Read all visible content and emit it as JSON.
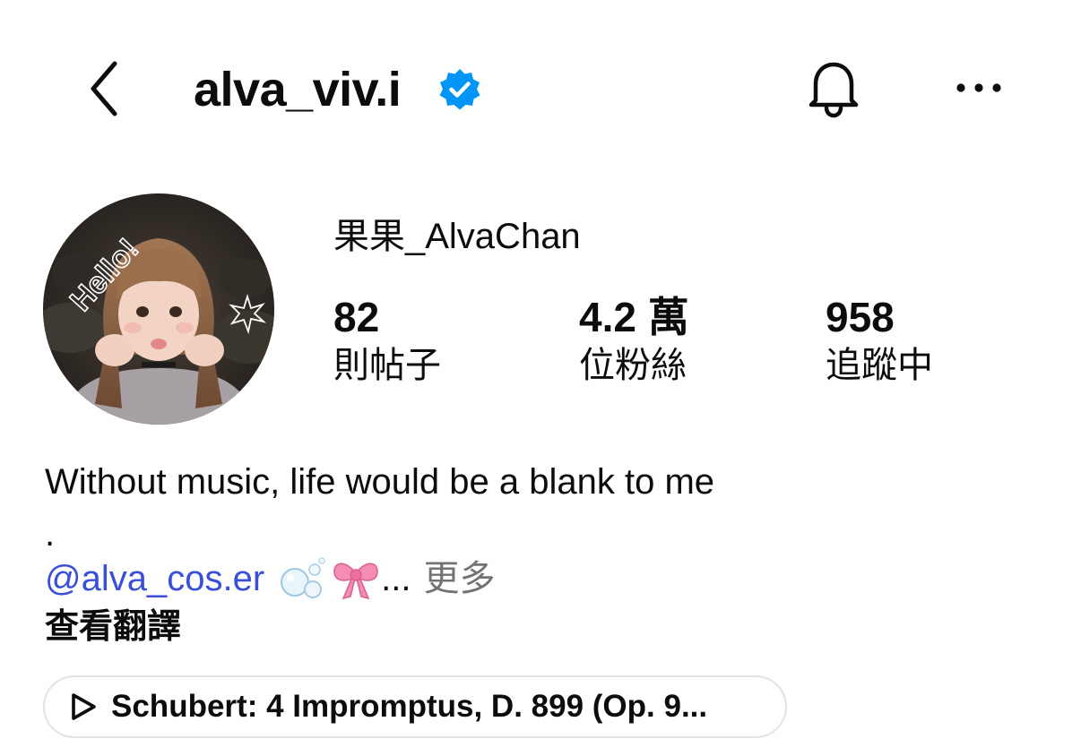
{
  "header": {
    "username": "alva_viv.i",
    "verified": true,
    "back_icon": "chevron-left-icon",
    "notifications_icon": "bell-icon",
    "more_icon": "more-horizontal-icon",
    "accent_color": "#0095f6"
  },
  "profile": {
    "display_name": "果果_AlvaChan",
    "avatar_text": "Hello!",
    "stats": {
      "posts": {
        "value": "82",
        "label": "則帖子"
      },
      "followers": {
        "value": "4.2 萬",
        "label": "位粉絲"
      },
      "following": {
        "value": "958",
        "label": "追蹤中"
      }
    }
  },
  "bio": {
    "line1": "Without music, life would be a blank to me",
    "line2": ".",
    "mention": "@alva_cos.er",
    "emojis": [
      "bubbles-icon",
      "ribbon-icon"
    ],
    "ellipsis": "...",
    "more_label": "更多",
    "translate_label": "查看翻譯",
    "mention_color": "#3a4fd8"
  },
  "music": {
    "icon": "play-icon",
    "title": "Schubert: 4 Impromptus, D. 899 (Op. 9..."
  }
}
